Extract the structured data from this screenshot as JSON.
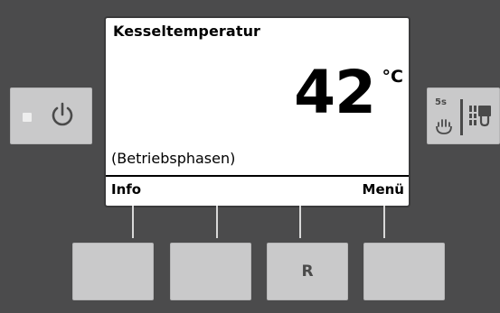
{
  "display": {
    "title": "Kesseltemperatur",
    "temperature_value": "42",
    "temperature_unit": "°C",
    "status_text": "(Betriebsphasen)",
    "softkey_left": "Info",
    "softkey_right": "Menü"
  },
  "buttons": {
    "soft_1_label": "",
    "soft_2_label": "",
    "soft_3_label": "R",
    "soft_4_label": "",
    "manual_time_label": "5s"
  },
  "icons": {
    "power": "power-icon",
    "manual": "hand-icon",
    "boiler": "boiler-tap-icon",
    "status_led": "led-indicator"
  },
  "colors": {
    "panel": "#4b4b4c",
    "button": "#c9c9ca",
    "screen": "#ffffff",
    "text": "#000000"
  }
}
